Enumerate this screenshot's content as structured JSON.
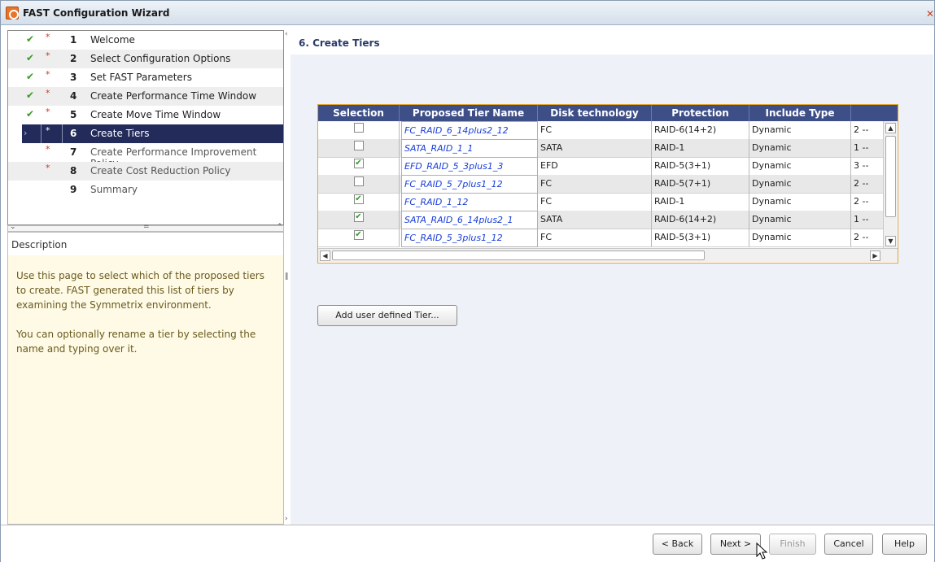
{
  "window": {
    "title": "FAST Configuration Wizard",
    "close_glyph": "✕"
  },
  "steps": [
    {
      "num": "1",
      "label": "Welcome",
      "done": true
    },
    {
      "num": "2",
      "label": "Select Configuration Options",
      "done": true
    },
    {
      "num": "3",
      "label": "Set FAST Parameters",
      "done": true
    },
    {
      "num": "4",
      "label": "Create Performance Time Window",
      "done": true
    },
    {
      "num": "5",
      "label": "Create Move Time Window",
      "done": true
    },
    {
      "num": "6",
      "label": "Create Tiers",
      "done": false,
      "selected": true
    },
    {
      "num": "7",
      "label": "Create Performance Improvement Policy",
      "done": false
    },
    {
      "num": "8",
      "label": "Create Cost Reduction Policy",
      "done": false
    },
    {
      "num": "9",
      "label": "Summary",
      "done": false
    }
  ],
  "description": {
    "header": "Description",
    "paragraphs": [
      "Use this page to select which of the proposed tiers to create. FAST generated this list of tiers by examining the Symmetrix environment.",
      "You can optionally rename a tier by selecting the name and typing over it."
    ]
  },
  "page": {
    "title": "6. Create Tiers"
  },
  "table": {
    "columns": [
      "Selection",
      "Proposed Tier Name",
      "Disk technology",
      "Protection",
      "Include Type",
      ""
    ],
    "rows": [
      {
        "selected": false,
        "name": "FC_RAID_6_14plus2_12",
        "disk": "FC",
        "protection": "RAID-6(14+2)",
        "include": "Dynamic",
        "extra": "2 --"
      },
      {
        "selected": false,
        "name": "SATA_RAID_1_1",
        "disk": "SATA",
        "protection": "RAID-1",
        "include": "Dynamic",
        "extra": "1 --"
      },
      {
        "selected": true,
        "name": "EFD_RAID_5_3plus1_3",
        "disk": "EFD",
        "protection": "RAID-5(3+1)",
        "include": "Dynamic",
        "extra": "3 --"
      },
      {
        "selected": false,
        "name": "FC_RAID_5_7plus1_12",
        "disk": "FC",
        "protection": "RAID-5(7+1)",
        "include": "Dynamic",
        "extra": "2 --"
      },
      {
        "selected": true,
        "name": "FC_RAID_1_12",
        "disk": "FC",
        "protection": "RAID-1",
        "include": "Dynamic",
        "extra": "2 --"
      },
      {
        "selected": true,
        "name": "SATA_RAID_6_14plus2_1",
        "disk": "SATA",
        "protection": "RAID-6(14+2)",
        "include": "Dynamic",
        "extra": "1 --"
      },
      {
        "selected": true,
        "name": "FC_RAID_5_3plus1_12",
        "disk": "FC",
        "protection": "RAID-5(3+1)",
        "include": "Dynamic",
        "extra": "2 --"
      }
    ]
  },
  "buttons": {
    "add_tier": "Add user defined Tier...",
    "back": "< Back",
    "next": "Next >",
    "finish": "Finish",
    "cancel": "Cancel",
    "help": "Help"
  },
  "colors": {
    "header_bg": "#3e4f87",
    "selected_step_bg": "#222b5a",
    "link_text": "#1a3fd8",
    "desc_bg": "#fefae5"
  }
}
